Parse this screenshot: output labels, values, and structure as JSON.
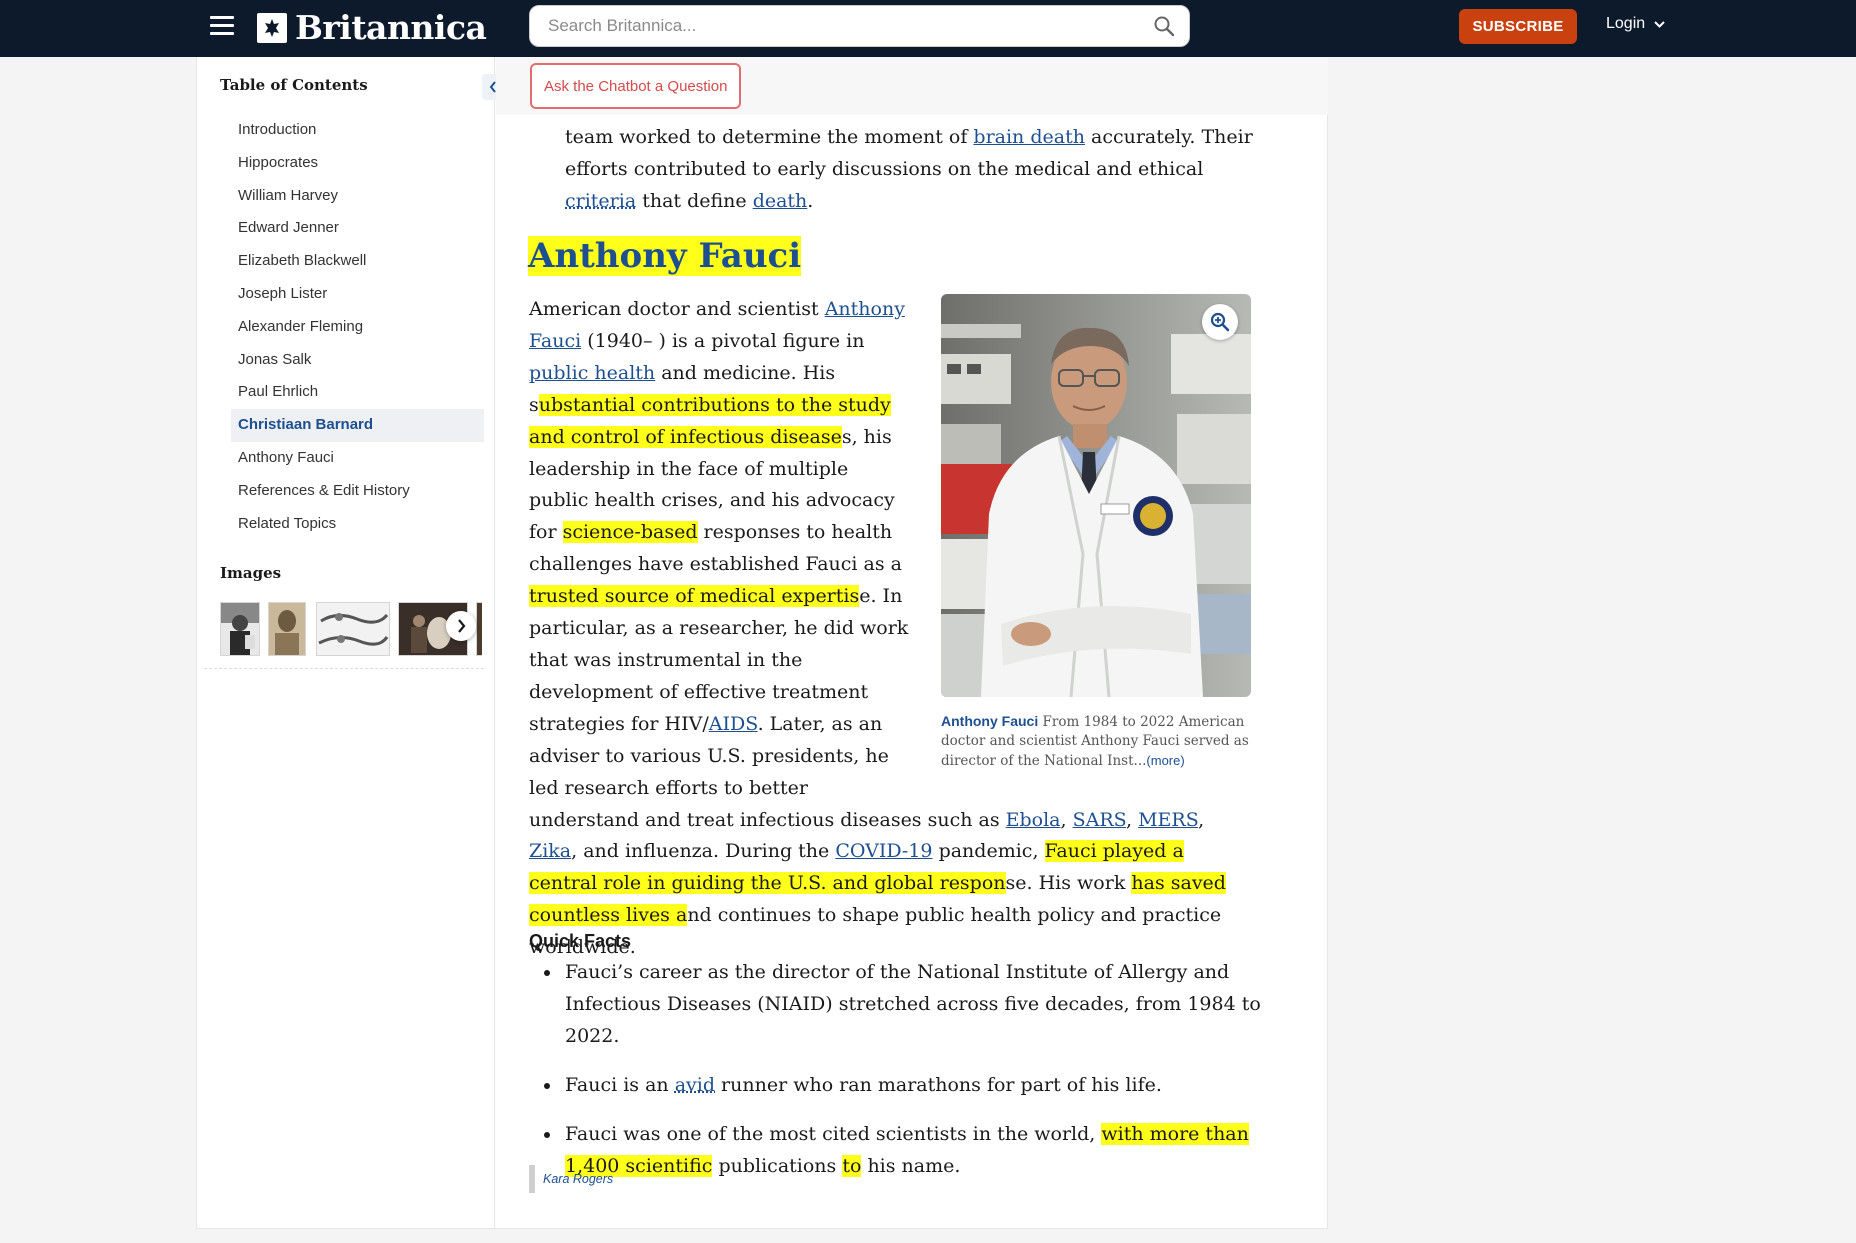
{
  "header": {
    "logo_text": "Britannica",
    "search_placeholder": "Search Britannica...",
    "subscribe_label": "SUBSCRIBE",
    "login_label": "Login"
  },
  "sidebar": {
    "toc_title": "Table of Contents",
    "items": [
      {
        "label": "Introduction",
        "active": false
      },
      {
        "label": "Hippocrates",
        "active": false
      },
      {
        "label": "William Harvey",
        "active": false
      },
      {
        "label": "Edward Jenner",
        "active": false
      },
      {
        "label": "Elizabeth Blackwell",
        "active": false
      },
      {
        "label": "Joseph Lister",
        "active": false
      },
      {
        "label": "Alexander Fleming",
        "active": false
      },
      {
        "label": "Jonas Salk",
        "active": false
      },
      {
        "label": "Paul Ehrlich",
        "active": false
      },
      {
        "label": "Christiaan Barnard",
        "active": true
      },
      {
        "label": "Anthony Fauci",
        "active": false
      },
      {
        "label": "References & Edit History",
        "active": false
      },
      {
        "label": "Related Topics",
        "active": false
      }
    ],
    "images_title": "Images"
  },
  "chatbot": {
    "label": "Ask the Chatbot a Question"
  },
  "article": {
    "prev_para": {
      "t1": "team worked to determine the moment of ",
      "l1": "brain death",
      "t2": " accurately. Their efforts contributed to early discussions on the medical and ethical ",
      "l2": "criteria",
      "t3": " that define ",
      "l3": "death",
      "t4": "."
    },
    "heading": "Anthony Fauci",
    "intro": {
      "t1": "American doctor and scientist ",
      "l1": "Anthony Fauci",
      "t2": " (1940– ) is a pivotal figure in ",
      "l2": "public health",
      "t3": " and medicine. His s",
      "h1": "ubstantial contributions to the study and control of infectious disease",
      "t4": "s, his leadership in the face of multiple public health crises, and his advocacy for ",
      "h2": "science-based",
      "t5": " responses to health challenges have established Fauci as a",
      "h3": " trusted source of medical expertis",
      "t6": "e. In particular, as a researcher, he did work that was instrumental in the development of effective treatment strategies for HIV/",
      "l3": "AIDS",
      "t7": ". Later, as an adviser to various U.S. presidents, he led research efforts to better understand and treat infectious diseases such as ",
      "l4": "Ebola",
      "t8": ", ",
      "l5": "SARS",
      "t9": ", ",
      "l6": "MERS",
      "t10": ", ",
      "l7": "Zika",
      "t11": ", and influenza. During the ",
      "l8": "COVID-19",
      "t12": " pandemic, ",
      "h4": "Fauci played a central role in guiding the U.S. and global respon",
      "t13": "se. His work ",
      "h5": "has saved countless lives a",
      "t14": "nd continues to shape public health policy and practice worldwide."
    },
    "figure": {
      "caption_name": "Anthony Fauci",
      "caption_text": "From 1984 to 2022 American doctor and scientist Anthony Fauci served as director of the National Inst...",
      "caption_more": "(more)"
    },
    "quick_facts": {
      "title": "Quick Facts",
      "f1": "Fauci’s career as the director of the National Institute of Allergy and Infectious Diseases (NIAID) stretched across five decades, from 1984 to 2022.",
      "f2a": "Fauci is an ",
      "f2l": "avid",
      "f2b": " runner who ran marathons for part of his life.",
      "f3a": "Fauci was one of the most cited scientists in the world, ",
      "f3h1": "with more than 1,400 scientific",
      "f3b": " publications ",
      "f3h2": "to",
      "f3c": " his name."
    },
    "author": "Kara Rogers"
  },
  "colors": {
    "topbar": "#0c1a2c",
    "subscribe": "#c8410f",
    "link": "#1d4f91",
    "highlight": "#ffff1a",
    "chat_border": "#e36c6c"
  }
}
